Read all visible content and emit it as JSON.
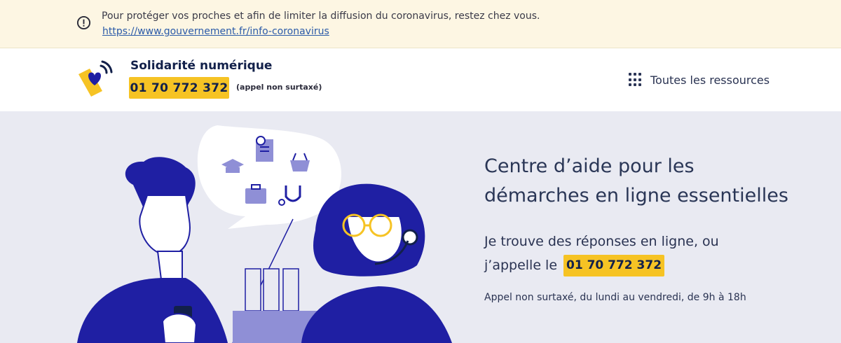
{
  "alert": {
    "message": "Pour protéger vos proches et afin de limiter la diffusion du coronavirus, restez chez vous.",
    "link": "https://www.gouvernement.fr/info-coronavirus"
  },
  "header": {
    "brand": "Solidarité numérique",
    "phone": "01 70 772 372",
    "phone_note": "(appel non surtaxé)",
    "resources_label": "Toutes les ressources"
  },
  "hero": {
    "title_line1": "Centre d’aide pour les",
    "title_line2": "démarches en ligne essentielles",
    "text_line1": "Je trouve des réponses en ligne, ou",
    "text_line2": "j’appelle le",
    "phone": "01 70 772 372",
    "note": "Appel non surtaxé, du lundi au vendredi, de 9h à 18h"
  },
  "colors": {
    "accent_yellow": "#f6c324",
    "navy": "#12204a",
    "illustration_blue": "#1f1fa3",
    "background": "#e9eaf2",
    "alert_bg": "#fdf6e3"
  }
}
